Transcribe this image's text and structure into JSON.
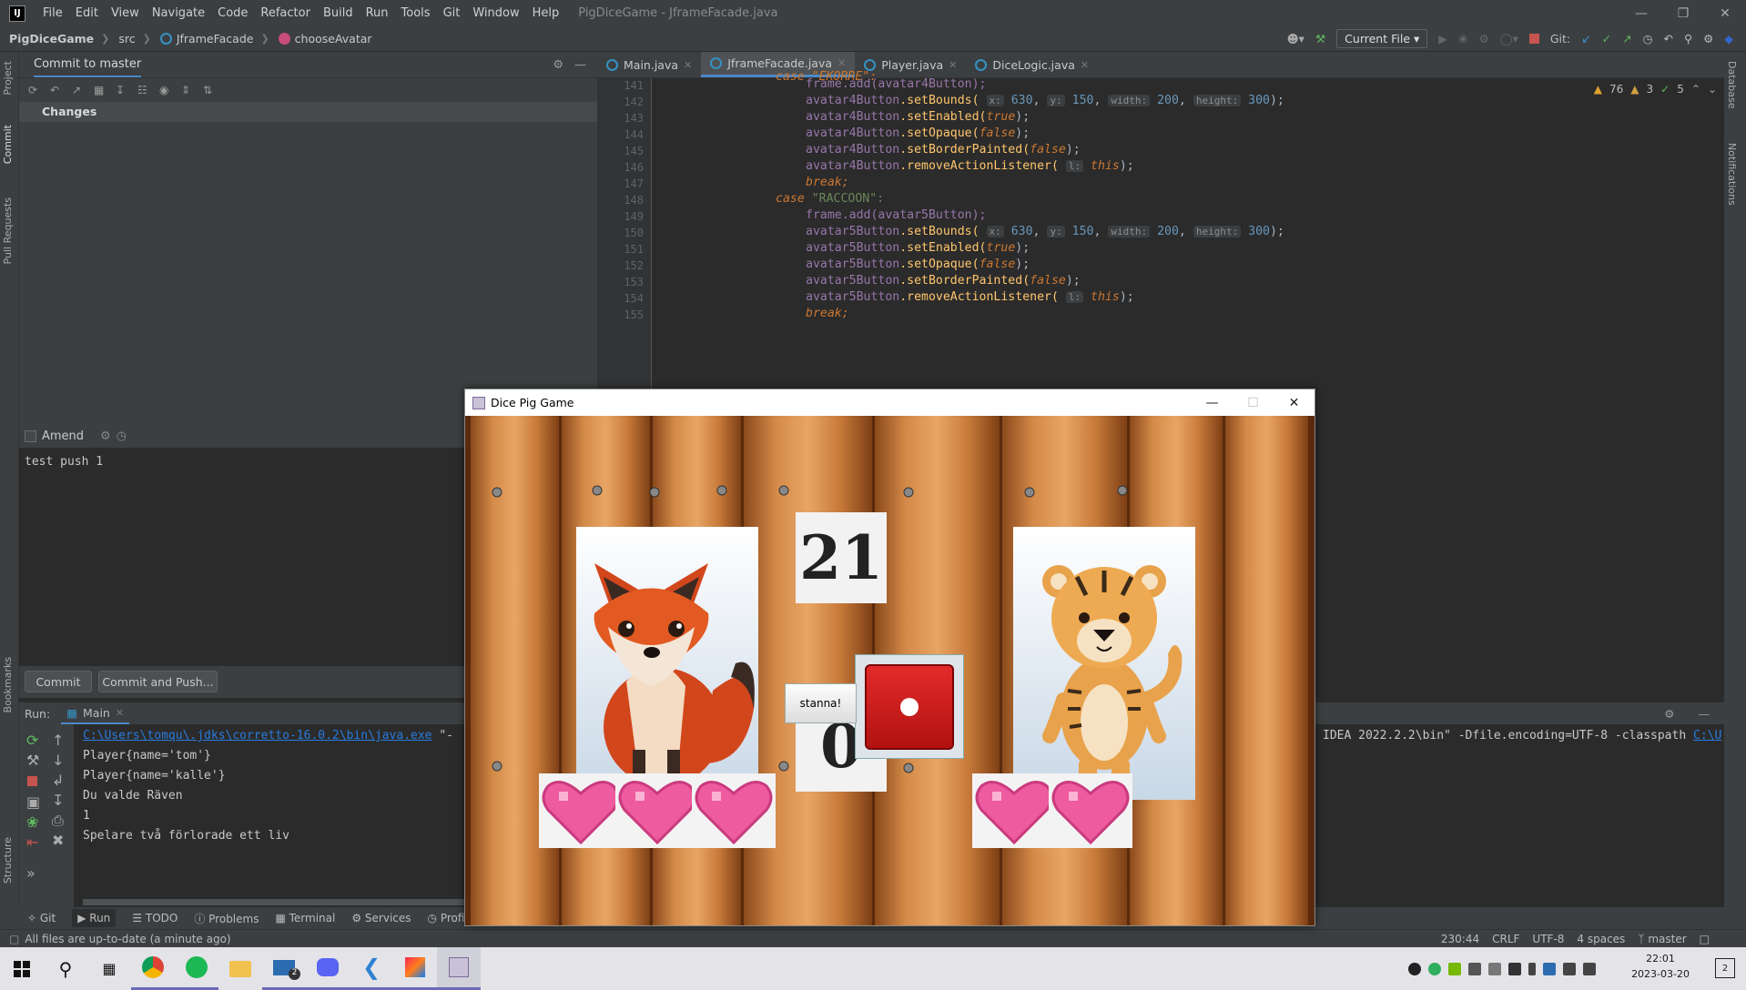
{
  "window_title": "PigDiceGame - JframeFacade.java",
  "menu": [
    "File",
    "Edit",
    "View",
    "Navigate",
    "Code",
    "Refactor",
    "Build",
    "Run",
    "Tools",
    "Git",
    "Window",
    "Help"
  ],
  "breadcrumb": [
    "PigDiceGame",
    "src",
    "JframeFacade",
    "chooseAvatar"
  ],
  "run_config": "Current File",
  "git_label": "Git:",
  "left_tool_tabs": [
    "Project",
    "Commit",
    "Pull Requests",
    "Bookmarks",
    "Structure"
  ],
  "right_tool_tabs": [
    "Database",
    "Notifications"
  ],
  "commit_panel": {
    "title": "Commit to master",
    "changes_label": "Changes",
    "amend_label": "Amend",
    "message": "test push 1",
    "commit_button": "Commit",
    "commit_push_button": "Commit and Push..."
  },
  "editor_tabs": [
    {
      "label": "Main.java",
      "active": false
    },
    {
      "label": "JframeFacade.java",
      "active": true
    },
    {
      "label": "Player.java",
      "active": false
    },
    {
      "label": "DiceLogic.java",
      "active": false
    }
  ],
  "inspections": {
    "warnings": "76",
    "weak_warnings": "3",
    "ok": "5"
  },
  "code": {
    "top_fragment": "case \"EKORRE\":",
    "lines": [
      "141",
      "142",
      "143",
      "144",
      "145",
      "146",
      "147",
      "148",
      "149",
      "150",
      "151",
      "152",
      "153",
      "154",
      "155"
    ],
    "a4_add": "frame.add(avatar4Button);",
    "a4_obj": "avatar4Button",
    "a5_add": "frame.add(avatar5Button);",
    "a5_obj": "avatar5Button",
    "set_bounds": ".setBounds(",
    "x_hint": "x:",
    "x_val": "630",
    "y_hint": "y:",
    "y_val": "150",
    "w_hint": "width:",
    "w_val": "200",
    "h_hint": "height:",
    "h_val": "300",
    "set_enabled": ".setEnabled(",
    "set_opaque": ".setOpaque(",
    "set_border": ".setBorderPainted(",
    "remove_listener": ".removeActionListener(",
    "l_hint": "l:",
    "this_kw": "this",
    "true_kw": "true",
    "false_kw": "false",
    "close_paren": ");",
    "sep": ",",
    "break_kw": "break;",
    "case_kw": "case",
    "case_str": "\"RACCOON\":"
  },
  "run_panel": {
    "label": "Run:",
    "tab": "Main",
    "cmd_path": "C:\\Users\\tomqu\\.jdks\\corretto-16.0.2\\bin\\java.exe",
    "cmd_rest": " \"-",
    "cmd_tail": "IDEA 2022.2.2\\bin\" -Dfile.encoding=UTF-8 -classpath ",
    "cmd_tail_link": "C:\\U",
    "output": [
      "Player{name='tom'}",
      "Player{name='kalle'}",
      "Du valde Räven",
      "1",
      "Spelare två förlorade ett liv"
    ]
  },
  "bottom_tabs": [
    "Git",
    "Run",
    "TODO",
    "Problems",
    "Terminal",
    "Services",
    "Profiler"
  ],
  "status": {
    "message": "All files are up-to-date (a minute ago)",
    "position": "230:44",
    "line_sep": "CRLF",
    "encoding": "UTF-8",
    "indent": "4 spaces",
    "branch": "master"
  },
  "game": {
    "title": "Dice Pig Game",
    "total_score": "21",
    "turn_score": "0",
    "stay_button": "stanna!",
    "player1_lives": 3,
    "player2_lives": 2
  },
  "taskbar": {
    "time": "22:01",
    "date": "2023-03-20",
    "mail_badge": "2",
    "notif_badge": "2"
  },
  "colors": {
    "ide_bg": "#2b2b2b",
    "panel_bg": "#3c3f41",
    "accent": "#4a88c7",
    "keyword": "#cc7832",
    "field": "#9876aa",
    "string": "#6a8759",
    "number": "#6897bb",
    "die_red": "#d11f1f",
    "heart_pink": "#ee5b9e"
  }
}
